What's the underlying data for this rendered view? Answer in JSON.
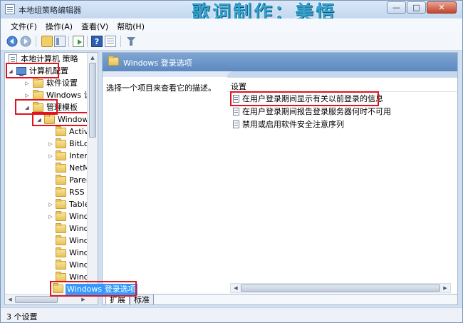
{
  "window": {
    "title": "本地组策略编辑器",
    "watermark": "歌词制作：美悟",
    "controls": {
      "minimize": "—",
      "maximize": "□",
      "close": "✕"
    }
  },
  "menu": [
    "文件(F)",
    "操作(A)",
    "查看(V)",
    "帮助(H)"
  ],
  "toolbar": {
    "icons": [
      "back-arrow-icon",
      "forward-arrow-icon",
      "up-folder-icon",
      "show-hide-tree-icon",
      "export-list-icon",
      "help-icon",
      "properties-icon",
      "filter-icon"
    ],
    "help_glyph": "?"
  },
  "tree": {
    "root": "本地计算机 策略",
    "computer_config": "计算机配置",
    "software_settings": "软件设置",
    "windows_settings": "Windows 设置",
    "admin_templates": "管理模板",
    "windows_components": "Windows",
    "children": [
      "Active",
      "BitLoc",
      "Intern",
      "NetM",
      "Parent",
      "RSS 提",
      "Tablet",
      "Windo",
      "Windo",
      "Windo",
      "Windo",
      "Windo",
      "Windo"
    ],
    "selected": "Windows 登录选项"
  },
  "right_pane": {
    "header": "Windows 登录选项",
    "description": "选择一个项目来查看它的描述。",
    "column_header": "设置",
    "settings": [
      "在用户登录期间显示有关以前登录的信息",
      "在用户登录期间报告登录服务器何时不可用",
      "禁用或启用软件安全注意序列"
    ]
  },
  "tabs": {
    "extended": "扩展",
    "standard": "标准"
  },
  "status": "3 个设置",
  "colors": {
    "highlight_box": "#e0141e",
    "selection": "#3399ff",
    "header_bg": "#5d89c0"
  }
}
